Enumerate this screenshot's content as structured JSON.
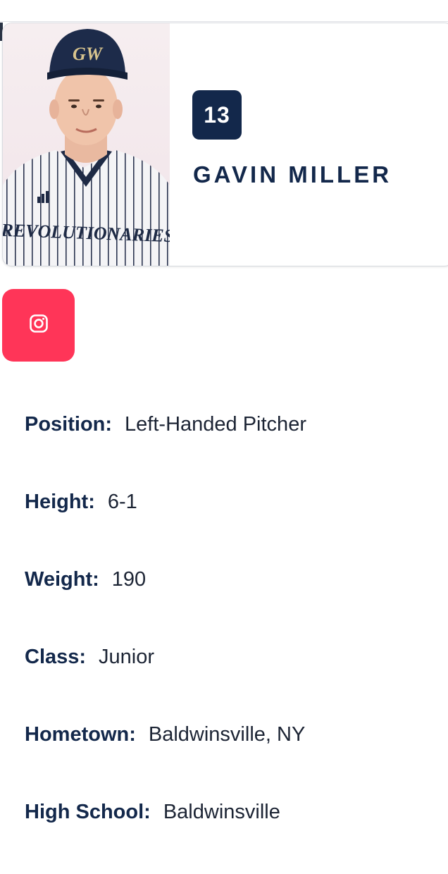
{
  "player": {
    "number": "13",
    "name": "GAVIN MILLER",
    "cap_logo": "GW",
    "jersey_text": "REVOLUTIONARIES"
  },
  "social": {
    "instagram_icon": "instagram-icon",
    "color": "#ff3558"
  },
  "bio": [
    {
      "label": "Position:",
      "value": "Left-Handed Pitcher"
    },
    {
      "label": "Height:",
      "value": "6-1"
    },
    {
      "label": "Weight:",
      "value": "190"
    },
    {
      "label": "Class:",
      "value": "Junior"
    },
    {
      "label": "Hometown:",
      "value": "Baldwinsville, NY"
    },
    {
      "label": "High School:",
      "value": "Baldwinsville"
    }
  ],
  "colors": {
    "navy": "#13284b",
    "instagram_pink": "#ff3558"
  }
}
